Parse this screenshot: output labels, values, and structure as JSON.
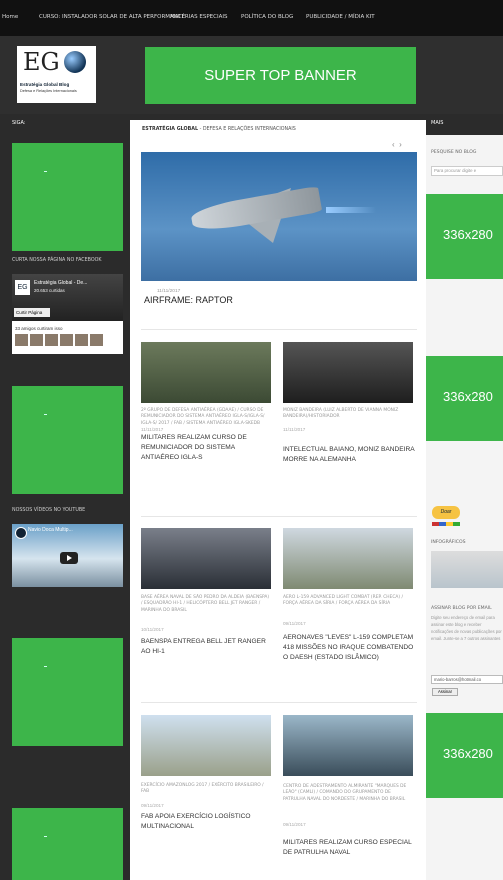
{
  "nav": {
    "items": [
      "Home",
      "CURSO: INSTALADOR SOLAR DE ALTA PERFORMANCE",
      "MATÉRIAS ESPECIAIS",
      "POLÍTICA DO BLOG",
      "PUBLICIDADE / MÍDIA KIT"
    ]
  },
  "logo": {
    "mark": "EG",
    "title": "Estratégia Global Blog",
    "subtitle": "Defesa e Relações Internacionais"
  },
  "banner": {
    "label": "SUPER TOP BANNER"
  },
  "columns": {
    "left": "SIGA:",
    "right": "MAIS"
  },
  "breadcrumb": {
    "blog": "ESTRATÉGIA GLOBAL",
    "section": "- DEFESA E RELAÇÕES INTERNACIONAIS"
  },
  "slider": {
    "prev": "‹",
    "next": "›"
  },
  "featured": {
    "date": "11/11/2017",
    "title": "AIRFRAME: RAPTOR"
  },
  "left": {
    "facebook_label": "CURTA NOSSA PÁGINA NO FACEBOOK",
    "fb_name": "Estratégia Global - De...",
    "fb_count": "20.653 curtidas",
    "fb_like": "Curtir Página",
    "fb_friends": "33 amigos curtiram isso",
    "youtube_label": "NOSSOS VÍDEOS NO YOUTUBE",
    "video_title": "Navio Doca Multip..."
  },
  "posts": [
    {
      "category": "2º GRUPO DE DEFESA ANTIAÉREA (GDAAE) / CURSO DE REMUNICIADOR DO SISTEMA ANTIAÉREO IGLA-S/IGLA-S/ IGLA-S/ 2017 / FAB / SISTEMA ANTIAÉREO IGLA-SKEDB",
      "date": "11/11/2017",
      "title": "MILITARES REALIZAM CURSO DE REMUNICIADOR DO SISTEMA ANTIAÉREO IGLA-S"
    },
    {
      "category": "MONIZ BANDEIRA (LUIZ ALBERTO DE VIANNA MONIZ BANDEIRA)/HISTORIADOR",
      "date": "11/11/2017",
      "title": "INTELECTUAL BAIANO, MONIZ BANDEIRA MORRE NA ALEMANHA"
    },
    {
      "category": "BASE AÉREA NAVAL DE SÃO PEDRO DA ALDEIA (BAENSPA) / ESQUADRÃO HI-1 / HELICÓPTERO BELL JET RANGER / MARINHA DO BRASIL",
      "date": "10/11/2017",
      "title": "BAENSPA ENTREGA BELL JET RANGER AO HI-1"
    },
    {
      "category": "AERO L-159 ADVANCED LIGHT COMBAT (REP. CHECA) / FORÇA AÉREA DA SÍRIA / FORÇA AÉREA DA SÍRIA",
      "date": "09/11/2017",
      "title": "AERONAVES \"LEVES\" L-159 COMPLETAM 418 MISSÕES NO IRAQUE COMBATENDO O DAESH (ESTADO ISLÂMICO)"
    },
    {
      "category": "EXERCÍCIO AMAZONLOG 2017 / EXÉRCITO BRASILEIRO / FAB",
      "date": "09/11/2017",
      "title": "FAB APOIA EXERCÍCIO LOGÍSTICO MULTINACIONAL"
    },
    {
      "category": "CENTRO DE ADESTRAMENTO ALMIRANTE \"MARQUES DE LEÃO\" (CAMLI) / COMANDO DO GRUPAMENTO DE PATRULHA NAVAL DO NORDESTE / MARINHA DO BRASIL",
      "date": "09/11/2017",
      "title": "MILITARES REALIZAM CURSO ESPECIAL DE PATRULHA NAVAL"
    }
  ],
  "right": {
    "search_label": "PESQUISE NO BLOG",
    "search_placeholder": "Para procurar digite e",
    "ads": [
      "336x280",
      "336x280",
      "336x280"
    ],
    "donate": "Doar",
    "infographics_label": "INFOGRÁFICOS",
    "subscribe_label": "ASSINAR BLOG POR EMAIL",
    "subscribe_text": "Digite seu endereço de email para assinar este blog e receber notificações de novas publicações por email. Junte-se a 7 outros assinantes",
    "email_value": "mario-barros@hotmail.co",
    "subscribe_button": "Assinar"
  },
  "colors": {
    "accent": "#3db54a",
    "dark": "#2b2b2b"
  }
}
